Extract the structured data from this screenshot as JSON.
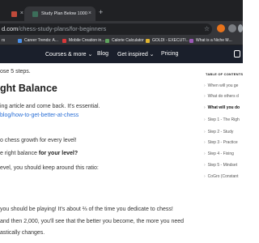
{
  "browser": {
    "tabs": [
      {
        "title": "",
        "active": false
      },
      {
        "title": "Study Plan Below 1000",
        "active": true
      }
    ],
    "new_tab": "+",
    "close": "×",
    "url_host": "d.com",
    "url_path": "/chess-study-plans/for-beginners",
    "bookmarks": [
      {
        "label": "rs"
      },
      {
        "label": "Career Trends: A..."
      },
      {
        "label": "Mobile Creation in..."
      },
      {
        "label": "Calorie Calculator"
      },
      {
        "label": "GOLDI - EXECUTI..."
      },
      {
        "label": "What is a Niche M..."
      }
    ]
  },
  "site": {
    "nav": [
      {
        "label": "Courses & more ⌄"
      },
      {
        "label": "Blog"
      },
      {
        "label": "Get inspired ⌄"
      },
      {
        "label": "Pricing"
      }
    ]
  },
  "article": {
    "line1": "ose 5 steps.",
    "heading": "ght Balance",
    "line2": "ing article and come back. It's essential.",
    "line3_link": "blog/how-to-get-better-at-chess",
    "line4": "o chess growth for every level!",
    "line5_a": "e right balance ",
    "line5_b": "for your level?",
    "line6": "evel, you should keep around this ratio:",
    "line7": "you should be playing! It's about ⅔ of the time you dedicate to chess!",
    "line8": "and then 2,000, you'll see that the better you become, the more you need",
    "line9": "astically changes."
  },
  "toc": {
    "title": "TABLE OF CONTENTS",
    "items": [
      {
        "label": "When will you ge"
      },
      {
        "label": "What do others d"
      },
      {
        "label": "What will you do"
      },
      {
        "label": "Step 1 - The Righ"
      },
      {
        "label": "Step 2 - Study"
      },
      {
        "label": "Step 3 - Practice"
      },
      {
        "label": "Step 4 - Fixing"
      },
      {
        "label": "Step 5 - Mindset"
      },
      {
        "label": "CoGro (Constant"
      }
    ],
    "chevron": "›"
  }
}
